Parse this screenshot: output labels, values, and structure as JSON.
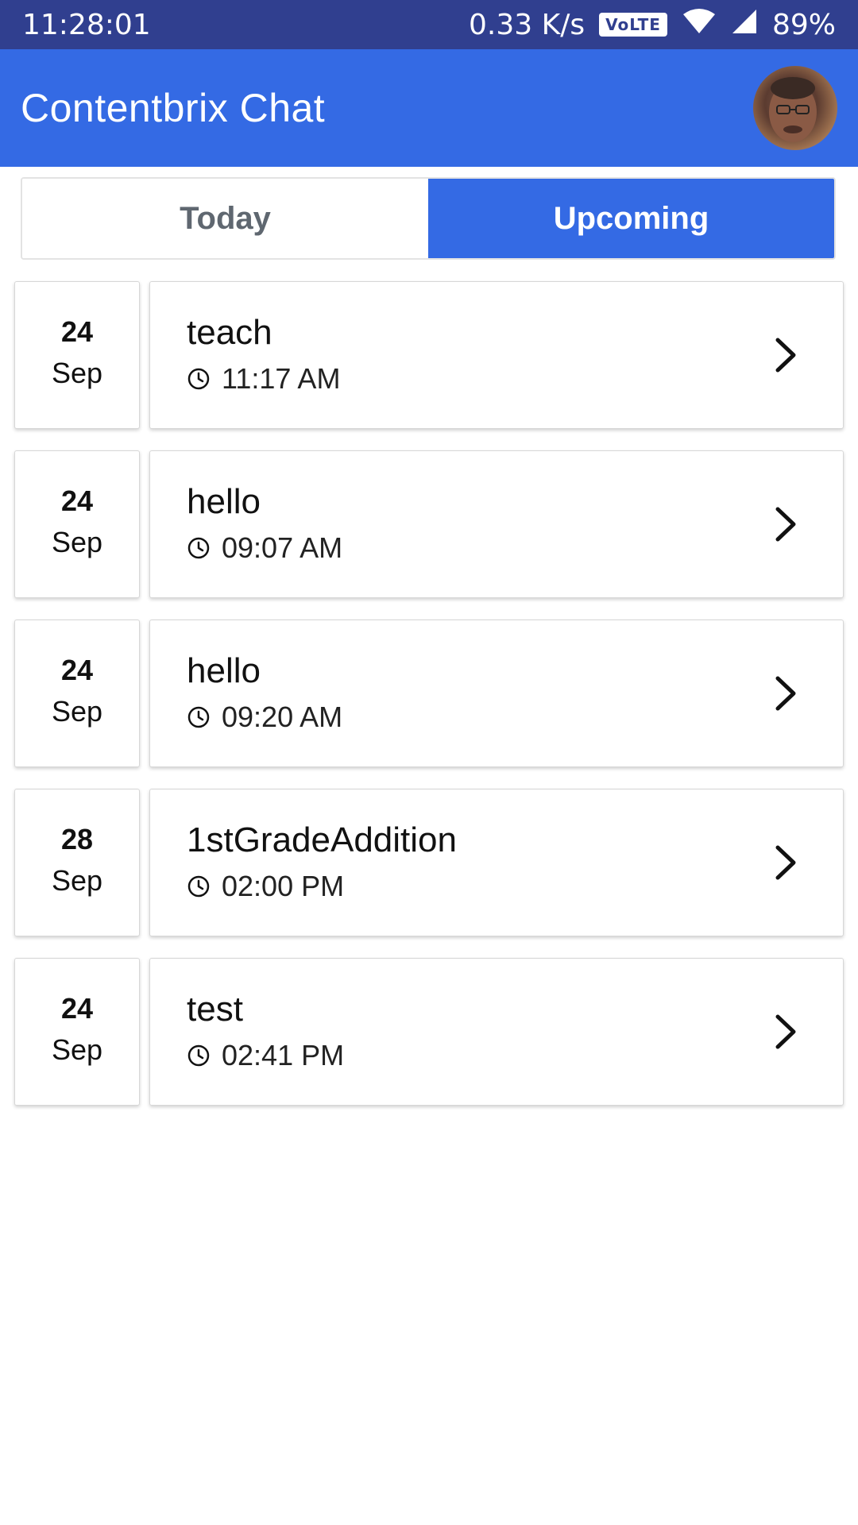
{
  "status_bar": {
    "time": "11:28:01",
    "network_speed": "0.33 K/s",
    "volte": "VoLTE",
    "battery": "89%",
    "icons": [
      "wifi-icon",
      "signal-icon"
    ]
  },
  "app_bar": {
    "title": "Contentbrix Chat",
    "avatar": "avatar"
  },
  "tabs": [
    {
      "label": "Today",
      "selected": false
    },
    {
      "label": "Upcoming",
      "selected": true
    }
  ],
  "events": [
    {
      "day": "24",
      "month": "Sep",
      "title": "teach",
      "time": "11:17 AM"
    },
    {
      "day": "24",
      "month": "Sep",
      "title": "hello",
      "time": "09:07 AM"
    },
    {
      "day": "24",
      "month": "Sep",
      "title": "hello",
      "time": "09:20 AM"
    },
    {
      "day": "28",
      "month": "Sep",
      "title": "1stGradeAddition",
      "time": "02:00 PM"
    },
    {
      "day": "24",
      "month": "Sep",
      "title": "test",
      "time": "02:41 PM"
    }
  ],
  "colors": {
    "status_bar": "#303f8f",
    "primary": "#346ae4",
    "tab_inactive_text": "#5f6770"
  }
}
